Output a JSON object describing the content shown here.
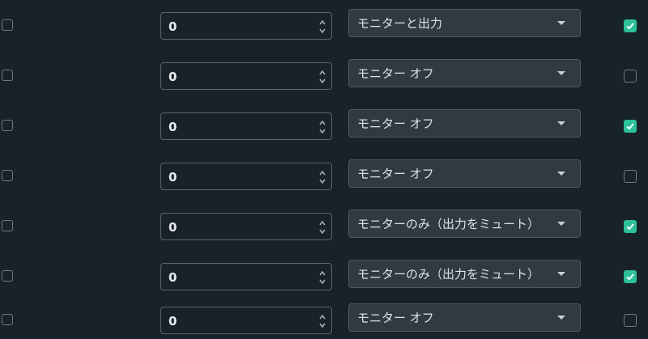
{
  "rows": [
    {
      "value": "0",
      "mode": "モニターと出力",
      "enabled": true
    },
    {
      "value": "0",
      "mode": "モニター オフ",
      "enabled": false
    },
    {
      "value": "0",
      "mode": "モニター オフ",
      "enabled": true
    },
    {
      "value": "0",
      "mode": "モニター オフ",
      "enabled": false
    },
    {
      "value": "0",
      "mode": "モニターのみ（出力をミュート）",
      "enabled": true
    },
    {
      "value": "0",
      "mode": "モニターのみ（出力をミュート）",
      "enabled": true
    },
    {
      "value": "0",
      "mode": "モニター オフ",
      "enabled": false
    }
  ],
  "colors": {
    "background": "#18222b",
    "accent_check": "#2cc09b",
    "dropdown_bg": "#2f3a43"
  },
  "icons": {
    "spinner": "up-down-chevrons-icon",
    "caret": "caret-down-icon",
    "check": "checkmark-icon"
  }
}
